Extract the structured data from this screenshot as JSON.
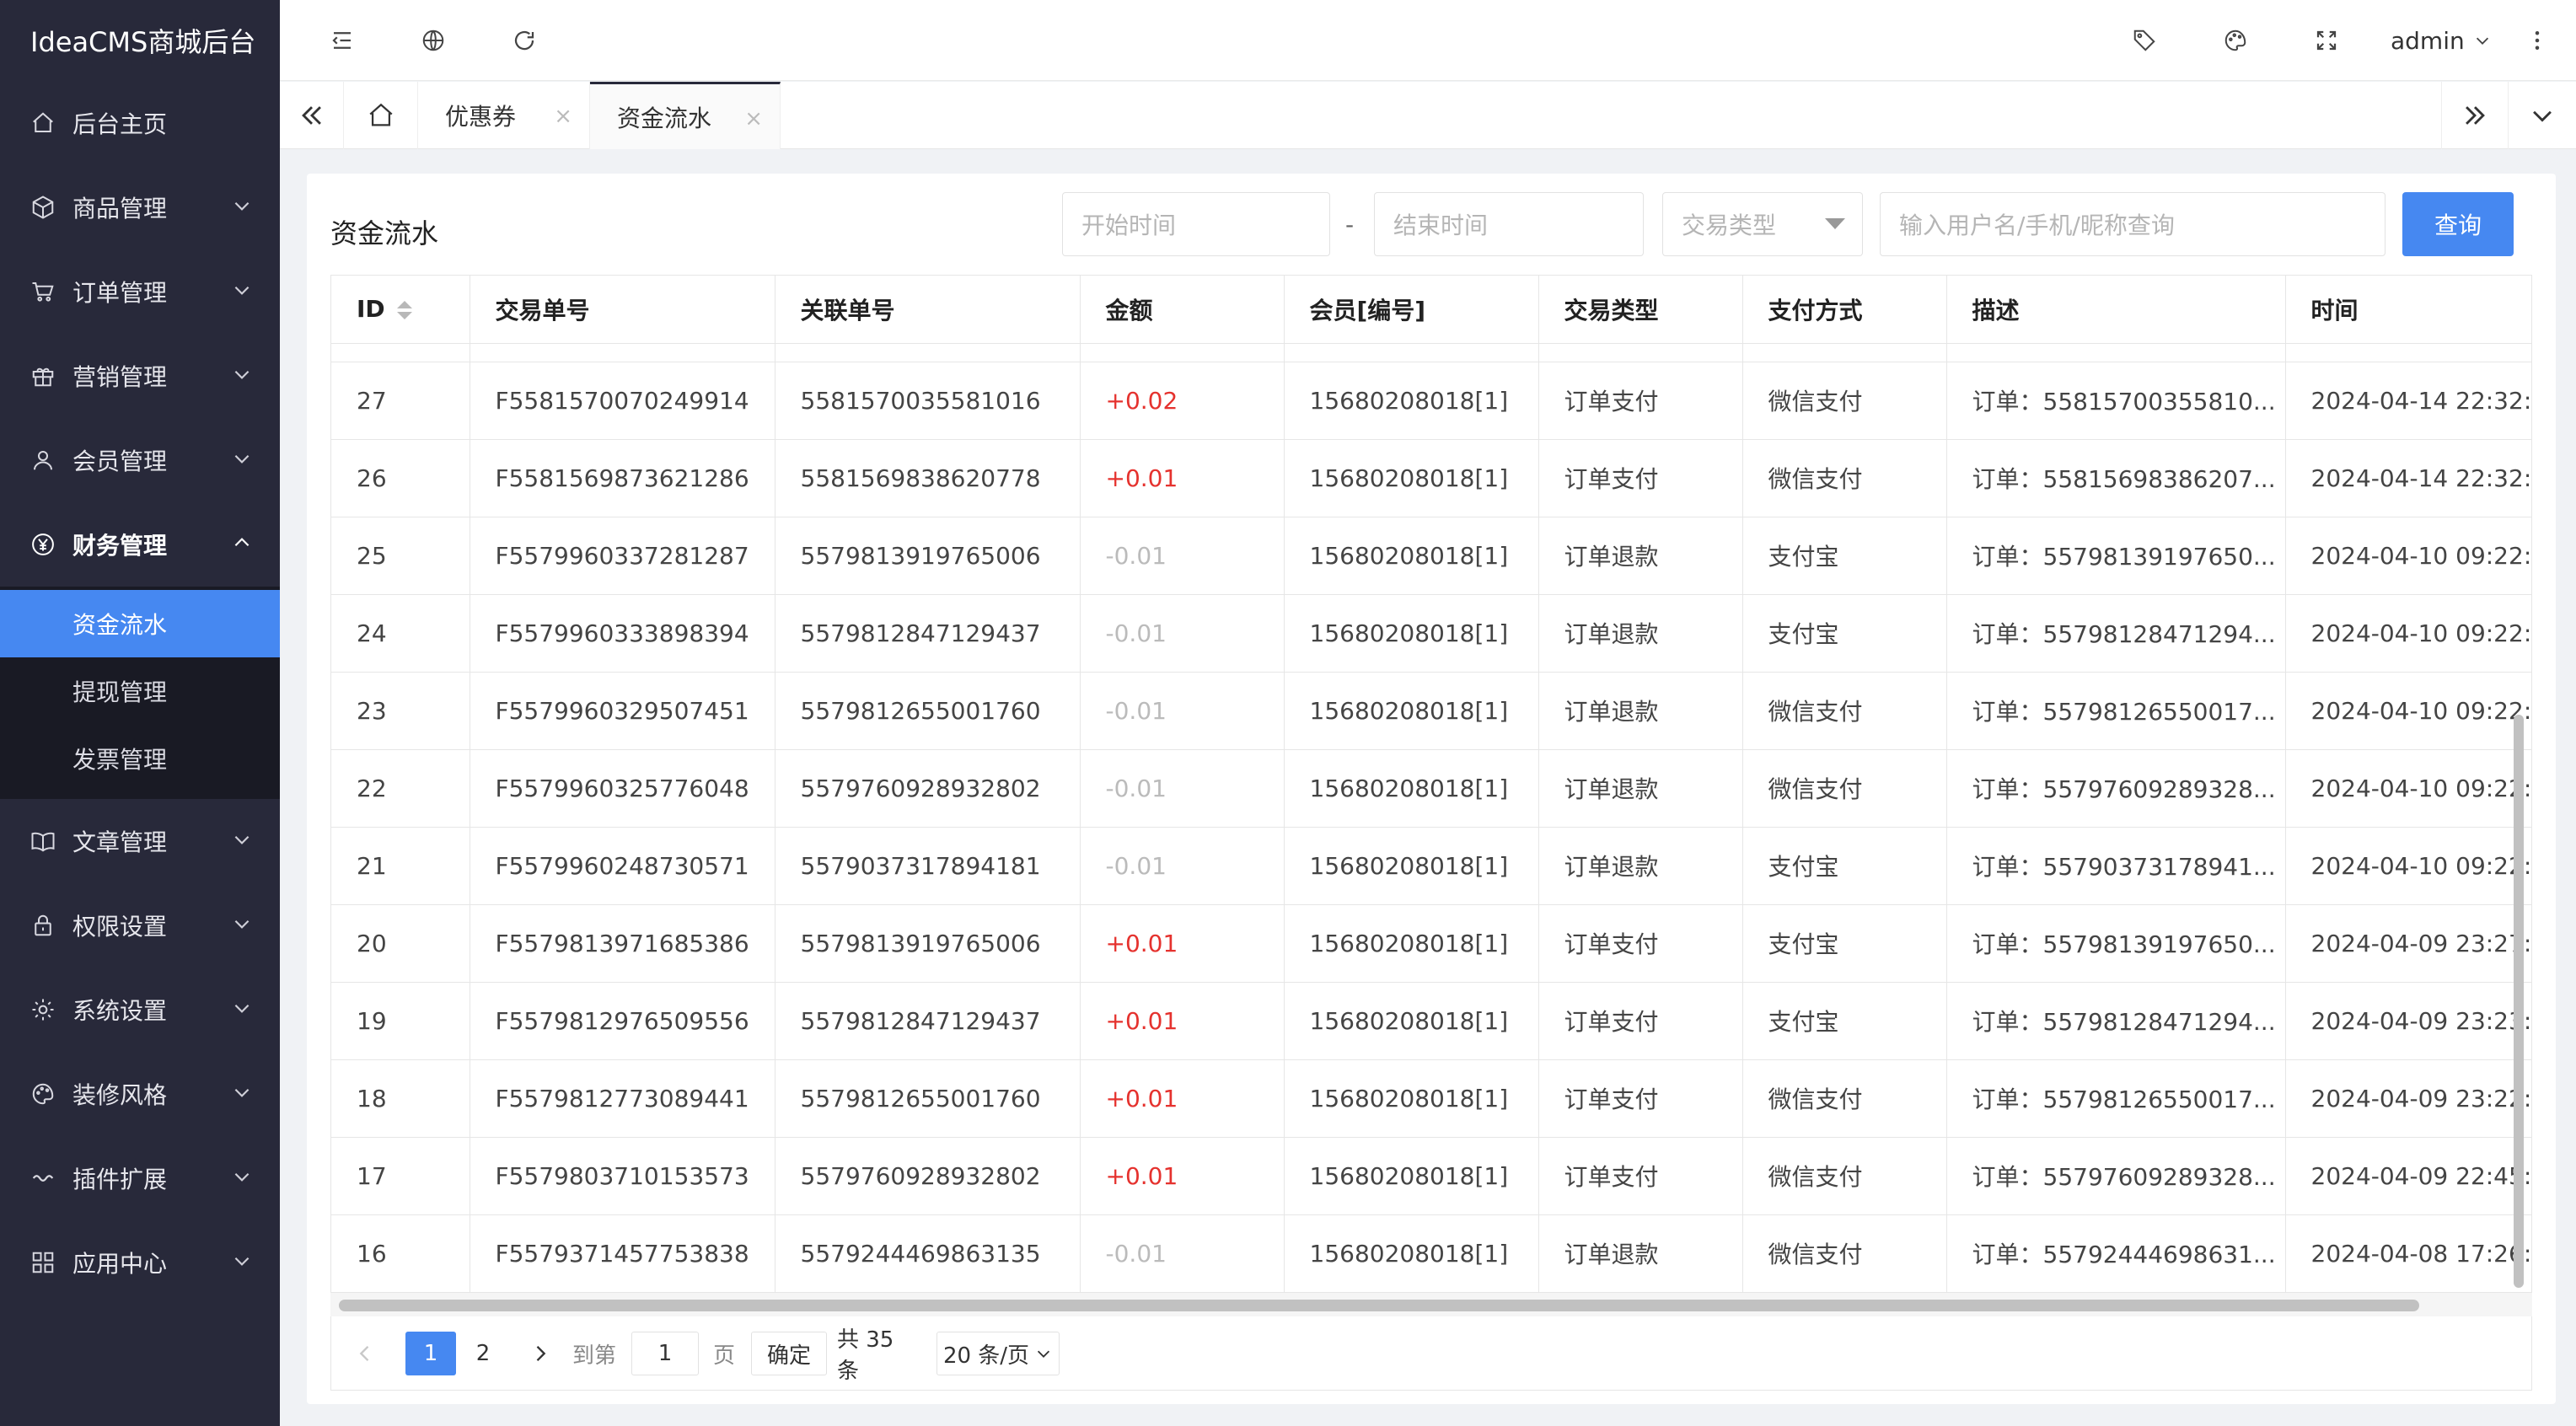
{
  "sidebar": {
    "logo": "IdeaCMS商城后台",
    "items": [
      {
        "label": "后台主页",
        "icon": "home-icon"
      },
      {
        "label": "商品管理",
        "icon": "box-icon"
      },
      {
        "label": "订单管理",
        "icon": "cart-icon"
      },
      {
        "label": "营销管理",
        "icon": "gift-icon"
      },
      {
        "label": "会员管理",
        "icon": "user-icon"
      },
      {
        "label": "财务管理",
        "icon": "yen-icon"
      },
      {
        "label": "文章管理",
        "icon": "book-icon"
      },
      {
        "label": "权限设置",
        "icon": "lock-icon"
      },
      {
        "label": "系统设置",
        "icon": "gear-icon"
      },
      {
        "label": "装修风格",
        "icon": "palette-icon"
      },
      {
        "label": "插件扩展",
        "icon": "link-icon"
      },
      {
        "label": "应用中心",
        "icon": "apps-icon"
      }
    ],
    "finance_sub": [
      "资金流水",
      "提现管理",
      "发票管理"
    ]
  },
  "topbar": {
    "user": "admin"
  },
  "tabs": [
    {
      "label": "优惠券",
      "close": "×"
    },
    {
      "label": "资金流水",
      "close": "×"
    }
  ],
  "page": {
    "title": "资金流水",
    "start_placeholder": "开始时间",
    "dash": "-",
    "end_placeholder": "结束时间",
    "type_placeholder": "交易类型",
    "search_placeholder": "输入用户名/手机/昵称查询",
    "query_label": "查询"
  },
  "table": {
    "columns": [
      "ID",
      "交易单号",
      "关联单号",
      "金额",
      "会员[编号]",
      "交易类型",
      "支付方式",
      "描述",
      "时间"
    ],
    "rows": [
      {
        "id": "27",
        "trade_no": "F5581570070249914",
        "related": "5581570035581016",
        "amount": "+0.02",
        "member": "15680208018[1]",
        "type": "订单支付",
        "pay": "微信支付",
        "desc": "订单：55815700355810...",
        "time": "2024-04-14 22:32:"
      },
      {
        "id": "26",
        "trade_no": "F5581569873621286",
        "related": "5581569838620778",
        "amount": "+0.01",
        "member": "15680208018[1]",
        "type": "订单支付",
        "pay": "微信支付",
        "desc": "订单：55815698386207...",
        "time": "2024-04-14 22:32:"
      },
      {
        "id": "25",
        "trade_no": "F5579960337281287",
        "related": "5579813919765006",
        "amount": "-0.01",
        "member": "15680208018[1]",
        "type": "订单退款",
        "pay": "支付宝",
        "desc": "订单：55798139197650...",
        "time": "2024-04-10 09:22:"
      },
      {
        "id": "24",
        "trade_no": "F5579960333898394",
        "related": "5579812847129437",
        "amount": "-0.01",
        "member": "15680208018[1]",
        "type": "订单退款",
        "pay": "支付宝",
        "desc": "订单：55798128471294...",
        "time": "2024-04-10 09:22:"
      },
      {
        "id": "23",
        "trade_no": "F5579960329507451",
        "related": "5579812655001760",
        "amount": "-0.01",
        "member": "15680208018[1]",
        "type": "订单退款",
        "pay": "微信支付",
        "desc": "订单：55798126550017...",
        "time": "2024-04-10 09:22:"
      },
      {
        "id": "22",
        "trade_no": "F5579960325776048",
        "related": "5579760928932802",
        "amount": "-0.01",
        "member": "15680208018[1]",
        "type": "订单退款",
        "pay": "微信支付",
        "desc": "订单：55797609289328...",
        "time": "2024-04-10 09:22:"
      },
      {
        "id": "21",
        "trade_no": "F5579960248730571",
        "related": "5579037317894181",
        "amount": "-0.01",
        "member": "15680208018[1]",
        "type": "订单退款",
        "pay": "支付宝",
        "desc": "订单：55790373178941...",
        "time": "2024-04-10 09:22:"
      },
      {
        "id": "20",
        "trade_no": "F5579813971685386",
        "related": "5579813919765006",
        "amount": "+0.01",
        "member": "15680208018[1]",
        "type": "订单支付",
        "pay": "支付宝",
        "desc": "订单：55798139197650...",
        "time": "2024-04-09 23:27:"
      },
      {
        "id": "19",
        "trade_no": "F5579812976509556",
        "related": "5579812847129437",
        "amount": "+0.01",
        "member": "15680208018[1]",
        "type": "订单支付",
        "pay": "支付宝",
        "desc": "订单：55798128471294...",
        "time": "2024-04-09 23:23:"
      },
      {
        "id": "18",
        "trade_no": "F5579812773089441",
        "related": "5579812655001760",
        "amount": "+0.01",
        "member": "15680208018[1]",
        "type": "订单支付",
        "pay": "微信支付",
        "desc": "订单：55798126550017...",
        "time": "2024-04-09 23:22:"
      },
      {
        "id": "17",
        "trade_no": "F5579803710153573",
        "related": "5579760928932802",
        "amount": "+0.01",
        "member": "15680208018[1]",
        "type": "订单支付",
        "pay": "微信支付",
        "desc": "订单：55797609289328...",
        "time": "2024-04-09 22:45:"
      },
      {
        "id": "16",
        "trade_no": "F5579371457753838",
        "related": "5579244469863135",
        "amount": "-0.01",
        "member": "15680208018[1]",
        "type": "订单退款",
        "pay": "微信支付",
        "desc": "订单：55792444698631...",
        "time": "2024-04-08 17:26:"
      }
    ]
  },
  "pagination": {
    "page1": "1",
    "page2": "2",
    "goto_label": "到第",
    "goto_value": "1",
    "page_unit": "页",
    "confirm": "确定",
    "total": "共 35 条",
    "page_size": "20 条/页"
  },
  "colors": {
    "sidebar_bg": "#28293a",
    "accent": "#4688f1",
    "positive": "#e5322e",
    "negative": "#bbbbbb"
  }
}
